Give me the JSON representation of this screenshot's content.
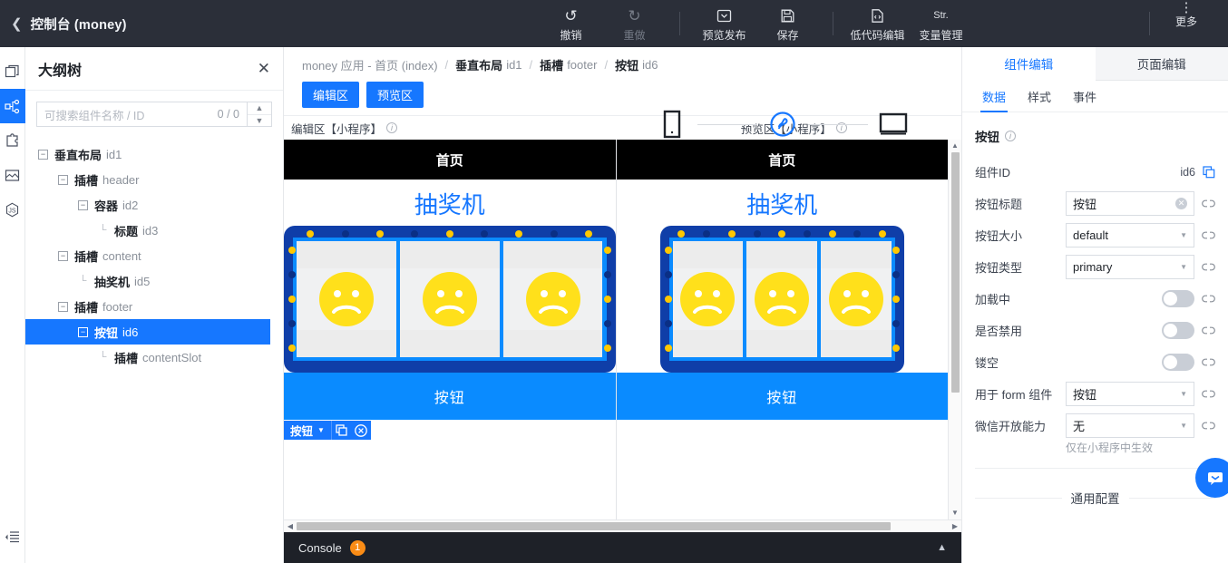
{
  "topbar": {
    "back_icon": "chevron-left-icon",
    "title": "控制台 (money)",
    "actions": [
      {
        "icon": "undo-icon",
        "glyph": "↺",
        "label": "撤销",
        "disabled": false
      },
      {
        "icon": "redo-icon",
        "glyph": "↻",
        "label": "重做",
        "disabled": true
      },
      {
        "icon": "preview-publish-icon",
        "glyph": "▣",
        "label": "预览发布",
        "disabled": false
      },
      {
        "icon": "save-icon",
        "glyph": "▤",
        "label": "保存",
        "disabled": false
      },
      {
        "icon": "lowcode-icon",
        "glyph": "▣",
        "label": "低代码编辑",
        "disabled": false
      },
      {
        "icon": "variable-icon",
        "glyph": "Str.",
        "label": "变量管理",
        "disabled": false
      }
    ],
    "more_label": "更多",
    "more_icon": "more-vertical-icon"
  },
  "rail": {
    "items": [
      {
        "icon": "pages-icon",
        "active": false
      },
      {
        "icon": "outline-tree-icon",
        "active": true
      },
      {
        "icon": "components-puzzle-icon",
        "active": false
      },
      {
        "icon": "assets-image-icon",
        "active": false
      },
      {
        "icon": "javascript-icon",
        "active": false
      }
    ],
    "collapse_icon": "collapse-panel-icon"
  },
  "outline": {
    "title": "大纲树",
    "close_icon": "close-icon",
    "search": {
      "placeholder": "可搜索组件名称 / ID",
      "value": "",
      "counter": "0 / 0",
      "up_icon": "chevron-up-icon",
      "down_icon": "chevron-down-icon"
    },
    "tree": [
      {
        "depth": 0,
        "toggle": "minus",
        "label": "垂直布局",
        "id": "id1",
        "selected": false
      },
      {
        "depth": 1,
        "toggle": "minus",
        "label": "插槽",
        "id": "header",
        "selected": false
      },
      {
        "depth": 2,
        "toggle": "minus",
        "label": "容器",
        "id": "id2",
        "selected": false
      },
      {
        "depth": 3,
        "toggle": "leaf",
        "label": "标题",
        "id": "id3",
        "selected": false
      },
      {
        "depth": 1,
        "toggle": "minus",
        "label": "插槽",
        "id": "content",
        "selected": false
      },
      {
        "depth": 2,
        "toggle": "leaf",
        "label": "抽奖机",
        "id": "id5",
        "selected": false
      },
      {
        "depth": 1,
        "toggle": "minus",
        "label": "插槽",
        "id": "footer",
        "selected": false
      },
      {
        "depth": 2,
        "toggle": "minus",
        "label": "按钮",
        "id": "id6",
        "selected": true
      },
      {
        "depth": 3,
        "toggle": "leaf",
        "label": "插槽",
        "id": "contentSlot",
        "selected": false
      }
    ]
  },
  "breadcrumb": {
    "app": "money 应用 - 首页 (index)",
    "items": [
      {
        "label": "垂直布局",
        "id": "id1"
      },
      {
        "label": "插槽",
        "id": "footer"
      },
      {
        "label": "按钮",
        "id": "id6"
      }
    ],
    "buttons": [
      {
        "label": "编辑区"
      },
      {
        "label": "预览区"
      }
    ]
  },
  "devices": [
    {
      "label": "H5",
      "icon": "phone-icon",
      "active": false
    },
    {
      "label": "小程序",
      "icon": "miniprogram-icon",
      "active": true
    },
    {
      "label": "PC",
      "icon": "desktop-icon",
      "active": false
    }
  ],
  "zones": {
    "edit_label": "编辑区【小程序】",
    "preview_label": "预览区【小程序】",
    "info_icon": "info-circle-icon"
  },
  "preview": {
    "page_title": "首页",
    "lottery_title": "抽奖机",
    "reel_face_icon": "sad-face-icon",
    "reel_count": 3,
    "button_label": "按钮",
    "colors": {
      "machine_frame": "#0f3ea8",
      "reel_border": "#0a8bff",
      "bulb": "#ffc800",
      "accent": "#1677ff",
      "face": "#ffe01b"
    }
  },
  "selection_badge": {
    "name": "按钮",
    "caret_icon": "caret-down-icon",
    "copy_icon": "copy-icon",
    "delete_icon": "close-circle-icon"
  },
  "console": {
    "label": "Console",
    "badge": "1",
    "chevron_icon": "chevron-up-icon"
  },
  "right_panel": {
    "tabs": [
      {
        "label": "组件编辑",
        "active": true
      },
      {
        "label": "页面编辑",
        "active": false
      }
    ],
    "subtabs": [
      {
        "label": "数据",
        "active": true
      },
      {
        "label": "样式",
        "active": false
      },
      {
        "label": "事件",
        "active": false
      }
    ],
    "section_title": "按钮",
    "section_info_icon": "info-circle-icon",
    "component_id": {
      "label": "组件ID",
      "value": "id6",
      "copy_icon": "copy-icon"
    },
    "fields": [
      {
        "label": "按钮标题",
        "type": "input",
        "value": "按钮",
        "clear_icon": "clear-circle-icon",
        "link_icon": "link-icon"
      },
      {
        "label": "按钮大小",
        "type": "select",
        "value": "default",
        "link_icon": "link-icon"
      },
      {
        "label": "按钮类型",
        "type": "select",
        "value": "primary",
        "link_icon": "link-icon"
      },
      {
        "label": "加载中",
        "type": "switch",
        "value": "off",
        "link_icon": "link-icon"
      },
      {
        "label": "是否禁用",
        "type": "switch",
        "value": "off",
        "link_icon": "link-icon"
      },
      {
        "label": "镂空",
        "type": "switch",
        "value": "off",
        "link_icon": "link-icon"
      },
      {
        "label": "用于 form 组件",
        "type": "select",
        "value": "按钮",
        "link_icon": "link-icon"
      },
      {
        "label": "微信开放能力",
        "type": "select",
        "value": "无",
        "link_icon": "link-icon"
      }
    ],
    "hint": "仅在小程序中生效",
    "general_section": "通用配置",
    "fab_icon": "chat-icon"
  }
}
